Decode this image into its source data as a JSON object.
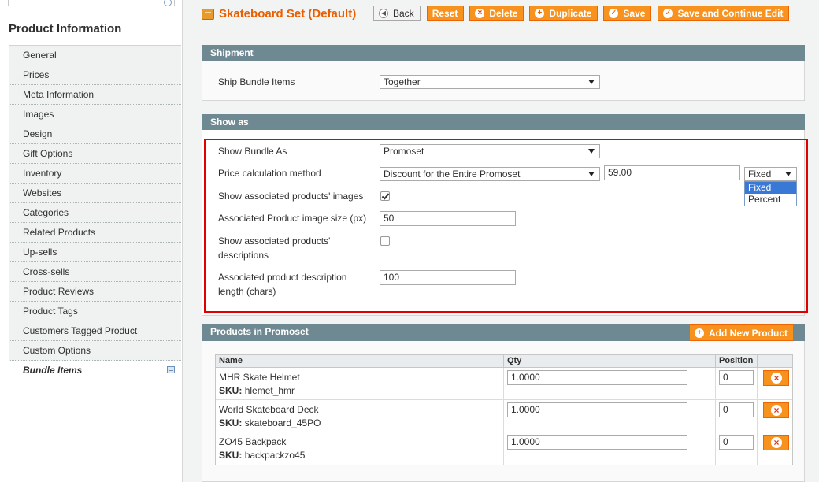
{
  "sidebar": {
    "title": "Product Information",
    "tabs": [
      {
        "label": "General"
      },
      {
        "label": "Prices"
      },
      {
        "label": "Meta Information"
      },
      {
        "label": "Images"
      },
      {
        "label": "Design"
      },
      {
        "label": "Gift Options"
      },
      {
        "label": "Inventory"
      },
      {
        "label": "Websites"
      },
      {
        "label": "Categories"
      },
      {
        "label": "Related Products"
      },
      {
        "label": "Up-sells"
      },
      {
        "label": "Cross-sells"
      },
      {
        "label": "Product Reviews"
      },
      {
        "label": "Product Tags"
      },
      {
        "label": "Customers Tagged Product"
      },
      {
        "label": "Custom Options"
      },
      {
        "label": "Bundle Items",
        "active": true
      }
    ]
  },
  "header": {
    "title": "Skateboard Set (Default)",
    "buttons": {
      "back": "Back",
      "reset": "Reset",
      "delete": "Delete",
      "duplicate": "Duplicate",
      "save": "Save",
      "save_continue": "Save and Continue Edit"
    }
  },
  "shipment": {
    "title": "Shipment",
    "ship_bundle_label": "Ship Bundle Items",
    "ship_bundle_value": "Together"
  },
  "show_as": {
    "title": "Show as",
    "show_bundle_label": "Show Bundle As",
    "show_bundle_value": "Promoset",
    "price_method_label": "Price calculation method",
    "price_method_value": "Discount for the Entire Promoset",
    "price_amount": "59.00",
    "discount_type_value": "Fixed",
    "discount_type_options": [
      "Fixed",
      "Percent"
    ],
    "show_images_label": "Show associated products' images",
    "show_images_checked": true,
    "image_size_label": "Associated Product image size (px)",
    "image_size_value": "50",
    "show_desc_label_1": "Show associated products'",
    "show_desc_label_2": "descriptions",
    "show_desc_checked": false,
    "desc_length_label_1": "Associated product description",
    "desc_length_label_2": "length (chars)",
    "desc_length_value": "100"
  },
  "products": {
    "title": "Products in Promoset",
    "add_button": "Add New Product",
    "columns": {
      "name": "Name",
      "qty": "Qty",
      "position": "Position"
    },
    "sku_label": "SKU:",
    "rows": [
      {
        "name": "MHR Skate Helmet",
        "sku": "hlemet_hmr",
        "qty": "1.0000",
        "position": "0"
      },
      {
        "name": "World Skateboard Deck",
        "sku": "skateboard_45PO",
        "qty": "1.0000",
        "position": "0"
      },
      {
        "name": "ZO45 Backpack",
        "sku": "backpackzo45",
        "qty": "1.0000",
        "position": "0"
      }
    ]
  }
}
